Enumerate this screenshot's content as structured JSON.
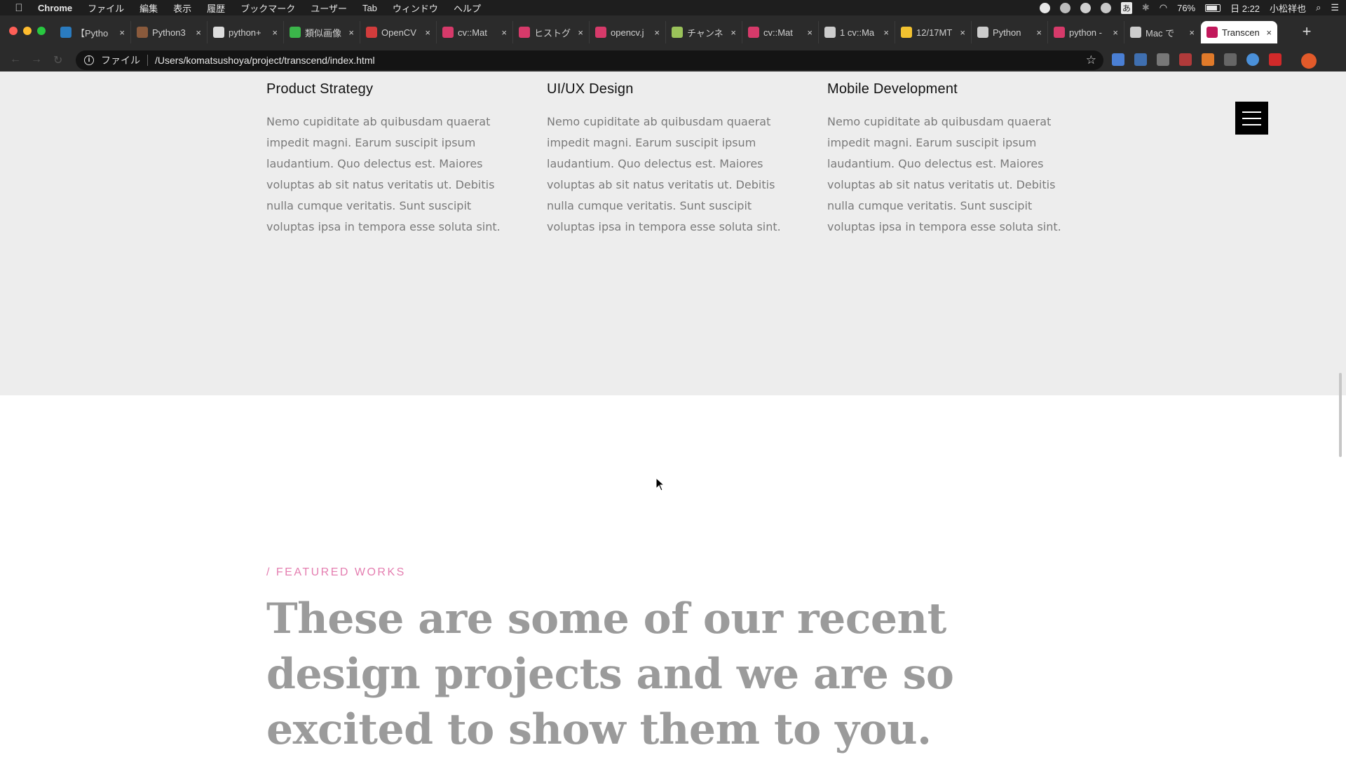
{
  "menubar": {
    "app_name": "Chrome",
    "items": [
      "ファイル",
      "編集",
      "表示",
      "履歴",
      "ブックマーク",
      "ユーザー",
      "Tab",
      "ウィンドウ",
      "ヘルプ"
    ],
    "battery": "76%",
    "clock": "日 2:22",
    "user": "小松祥也"
  },
  "tabs": [
    {
      "title": "【Pytho",
      "favicon_color": "#2a7bbf"
    },
    {
      "title": "Python3",
      "favicon_color": "#8a5a3c"
    },
    {
      "title": "python+",
      "favicon_color": "#dddddd"
    },
    {
      "title": "類似画像",
      "favicon_color": "#3bb54a"
    },
    {
      "title": "OpenCV",
      "favicon_color": "#d23c3c"
    },
    {
      "title": "cv::Mat",
      "favicon_color": "#d63a6a"
    },
    {
      "title": "ヒストグ",
      "favicon_color": "#d63a6a"
    },
    {
      "title": "opencv.j",
      "favicon_color": "#d63a6a"
    },
    {
      "title": "チャンネ",
      "favicon_color": "#9ac25a"
    },
    {
      "title": "cv::Mat",
      "favicon_color": "#d63a6a"
    },
    {
      "title": "1 cv::Ma",
      "favicon_color": "#cccccc"
    },
    {
      "title": "12/17MT",
      "favicon_color": "#f2c230"
    },
    {
      "title": "Python",
      "favicon_color": "#cccccc"
    },
    {
      "title": "python -",
      "favicon_color": "#d63a6a"
    },
    {
      "title": "Mac で",
      "favicon_color": "#cccccc"
    },
    {
      "title": "Transcen",
      "favicon_color": "#c2185b",
      "active": true
    }
  ],
  "address_bar": {
    "scheme_label": "ファイル",
    "url": "/Users/komatsushoya/project/transcend/index.html"
  },
  "services": [
    {
      "title": "Product Strategy",
      "body": "Nemo cupiditate ab quibusdam quaerat impedit magni. Earum suscipit ipsum laudantium. Quo delectus est. Maiores voluptas ab sit natus veritatis ut. Debitis nulla cumque veritatis. Sunt suscipit voluptas ipsa in tempora esse soluta sint."
    },
    {
      "title": "UI/UX Design",
      "body": "Nemo cupiditate ab quibusdam quaerat impedit magni. Earum suscipit ipsum laudantium. Quo delectus est. Maiores voluptas ab sit natus veritatis ut. Debitis nulla cumque veritatis. Sunt suscipit voluptas ipsa in tempora esse soluta sint."
    },
    {
      "title": "Mobile Development",
      "body": "Nemo cupiditate ab quibusdam quaerat impedit magni. Earum suscipit ipsum laudantium. Quo delectus est. Maiores voluptas ab sit natus veritatis ut. Debitis nulla cumque veritatis. Sunt suscipit voluptas ipsa in tempora esse soluta sint."
    }
  ],
  "featured": {
    "eyebrow": "/ FEATURED WORKS",
    "heading": "These are some of our recent design projects and we are so excited to show them to you."
  },
  "colors": {
    "accent_pink": "#e47eb0",
    "section_bg": "#ededed",
    "heading_gray": "#9b9b9b"
  }
}
